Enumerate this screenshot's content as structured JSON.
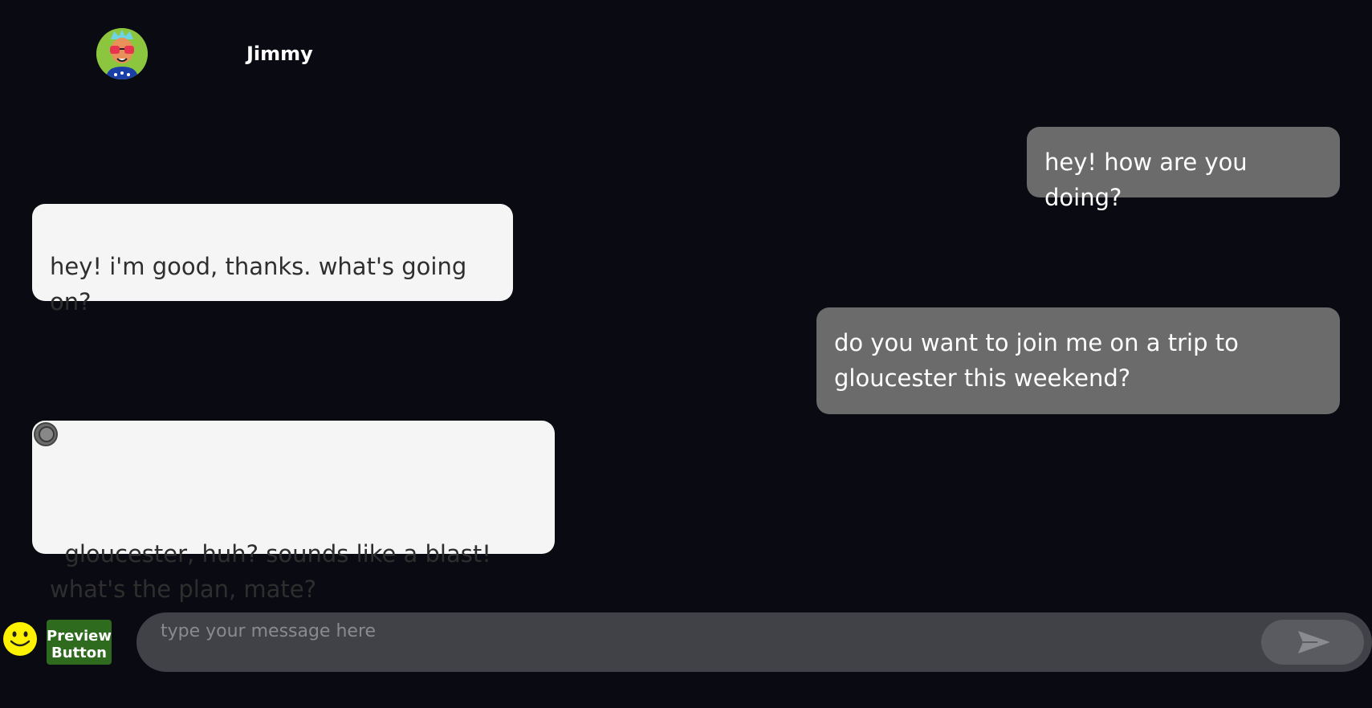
{
  "contact": {
    "name": "Jimmy",
    "avatar_icon": "avatar-with-sunglasses"
  },
  "messages": [
    {
      "direction": "sent",
      "text": "hey! how are you doing?"
    },
    {
      "direction": "received",
      "text": "hey! i'm good, thanks. what's going on?"
    },
    {
      "direction": "sent",
      "text": "do you want to join me on a trip to\ngloucester this weekend?"
    },
    {
      "direction": "received",
      "text": "gloucester, huh? sounds like a blast!\nwhat's the plan, mate?"
    }
  ],
  "composer": {
    "emoji_icon": "smiley-icon",
    "preview_button_label": "Preview\nButton",
    "input_value": "",
    "input_placeholder": "type your message here",
    "send_icon": "send-arrow-icon"
  },
  "colors": {
    "background": "#0a0b12",
    "sent_bubble": "#6b6b6b",
    "received_bubble": "#f5f5f5",
    "preview_button": "#2e6b1f",
    "emoji": "#fff200",
    "input_bar": "#414248"
  }
}
